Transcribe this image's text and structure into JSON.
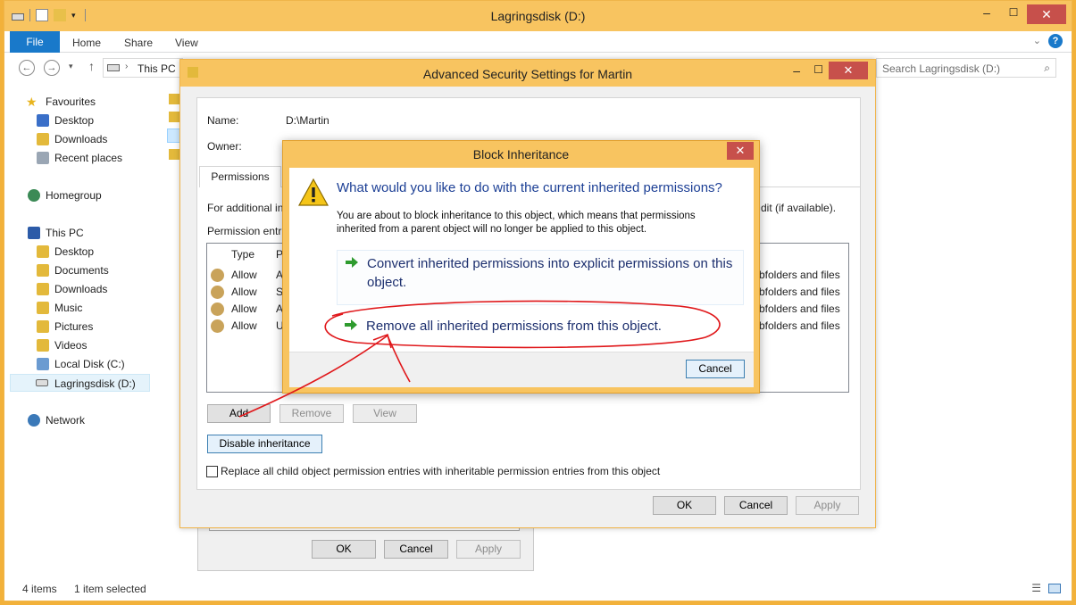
{
  "explorer": {
    "title": "Lagringsdisk (D:)",
    "ribbon_tabs": [
      "File",
      "Home",
      "Share",
      "View"
    ],
    "address_path": "This PC",
    "search_placeholder": "Search Lagringsdisk (D:)",
    "nav": {
      "favourites": "Favourites",
      "desktop": "Desktop",
      "downloads": "Downloads",
      "recent": "Recent places",
      "homegroup": "Homegroup",
      "this_pc": "This PC",
      "pc_desktop": "Desktop",
      "documents": "Documents",
      "pc_downloads": "Downloads",
      "music": "Music",
      "pictures": "Pictures",
      "videos": "Videos",
      "local_disk": "Local Disk (C:)",
      "lagringsdisk": "Lagringsdisk (D:)",
      "network": "Network"
    },
    "status": {
      "items": "4 items",
      "selected": "1 item selected"
    }
  },
  "properties_dialog": {
    "ok": "OK",
    "cancel": "Cancel",
    "apply": "Apply"
  },
  "advanced": {
    "title": "Advanced Security Settings for Martin",
    "name_label": "Name:",
    "name_value": "D:\\Martin",
    "owner_label": "Owner:",
    "tab": "Permissions",
    "info_prefix": "For additional in",
    "info_suffix": "dit (if available).",
    "entries_label": "Permission entri",
    "columns": {
      "type": "Type",
      "principal": "P"
    },
    "rows": [
      {
        "type": "Allow",
        "principal": "A",
        "applies": "bfolders and files"
      },
      {
        "type": "Allow",
        "principal": "S",
        "applies": "bfolders and files"
      },
      {
        "type": "Allow",
        "principal": "A",
        "applies": "bfolders and files"
      },
      {
        "type": "Allow",
        "principal": "U",
        "applies": "bfolders and files"
      }
    ],
    "add": "Add",
    "remove": "Remove",
    "view": "View",
    "disable_inheritance": "Disable inheritance",
    "replace_label": "Replace all child object permission entries with inheritable permission entries from this object",
    "ok": "OK",
    "cancel": "Cancel",
    "apply": "Apply"
  },
  "block": {
    "title": "Block Inheritance",
    "question": "What would you like to do with the current inherited permissions?",
    "description": "You are about to block inheritance to this object, which means that permissions inherited from a parent object will no longer be applied to this object.",
    "convert": "Convert inherited permissions into explicit permissions on this object.",
    "remove": "Remove all inherited permissions from this object.",
    "cancel": "Cancel"
  },
  "colors": {
    "accent": "#f8c460",
    "close": "#c7504b",
    "link": "#1c3f95",
    "annotation": "#e0181b"
  }
}
